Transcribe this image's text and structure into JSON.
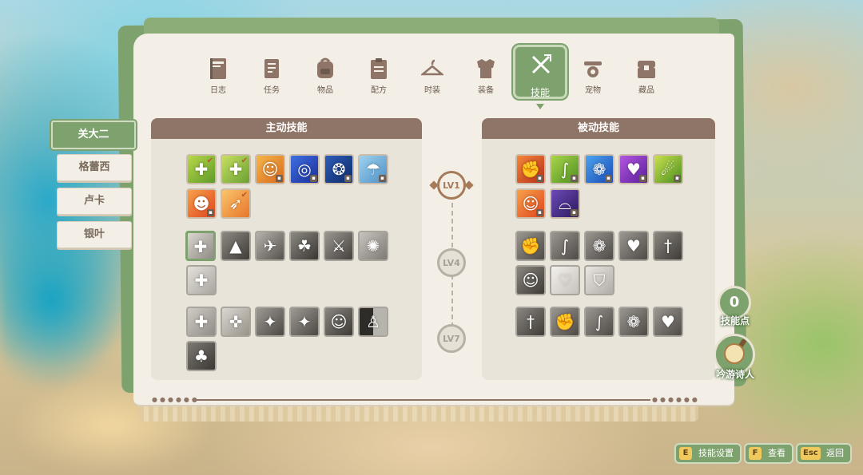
{
  "nav": {
    "items": [
      {
        "label": "日志",
        "icon": "journal-icon"
      },
      {
        "label": "任务",
        "icon": "quest-scroll-icon"
      },
      {
        "label": "物品",
        "icon": "backpack-icon"
      },
      {
        "label": "配方",
        "icon": "recipe-clipboard-icon"
      },
      {
        "label": "时装",
        "icon": "hanger-icon"
      },
      {
        "label": "装备",
        "icon": "armor-icon"
      },
      {
        "label": "技能",
        "icon": "skills-swords-icon",
        "active": true
      },
      {
        "label": "宠物",
        "icon": "pet-bowl-icon"
      },
      {
        "label": "藏品",
        "icon": "treasure-chest-icon"
      }
    ]
  },
  "characters": {
    "tabs": [
      {
        "label": "关大二",
        "active": true
      },
      {
        "label": "格蕾西"
      },
      {
        "label": "卢卡"
      },
      {
        "label": "银叶"
      }
    ]
  },
  "sections": {
    "active_title": "主动技能",
    "passive_title": "被动技能"
  },
  "levels": {
    "lv1": "LV1",
    "lv4": "LV4",
    "lv7": "LV7"
  },
  "skill_points": {
    "value": "0",
    "label": "技能点"
  },
  "job": {
    "label": "吟游诗人",
    "icon": "lute-icon"
  },
  "hints": {
    "settings": {
      "key": "E",
      "label": "技能设置"
    },
    "view": {
      "key": "F",
      "label": "查看"
    },
    "back": {
      "key": "Esc",
      "label": "返回"
    }
  },
  "colors": {
    "accent_green": "#7da26d",
    "header_brown": "#8e7567",
    "panel_cream": "#f3efe6",
    "key_yellow": "#f0c95e"
  }
}
